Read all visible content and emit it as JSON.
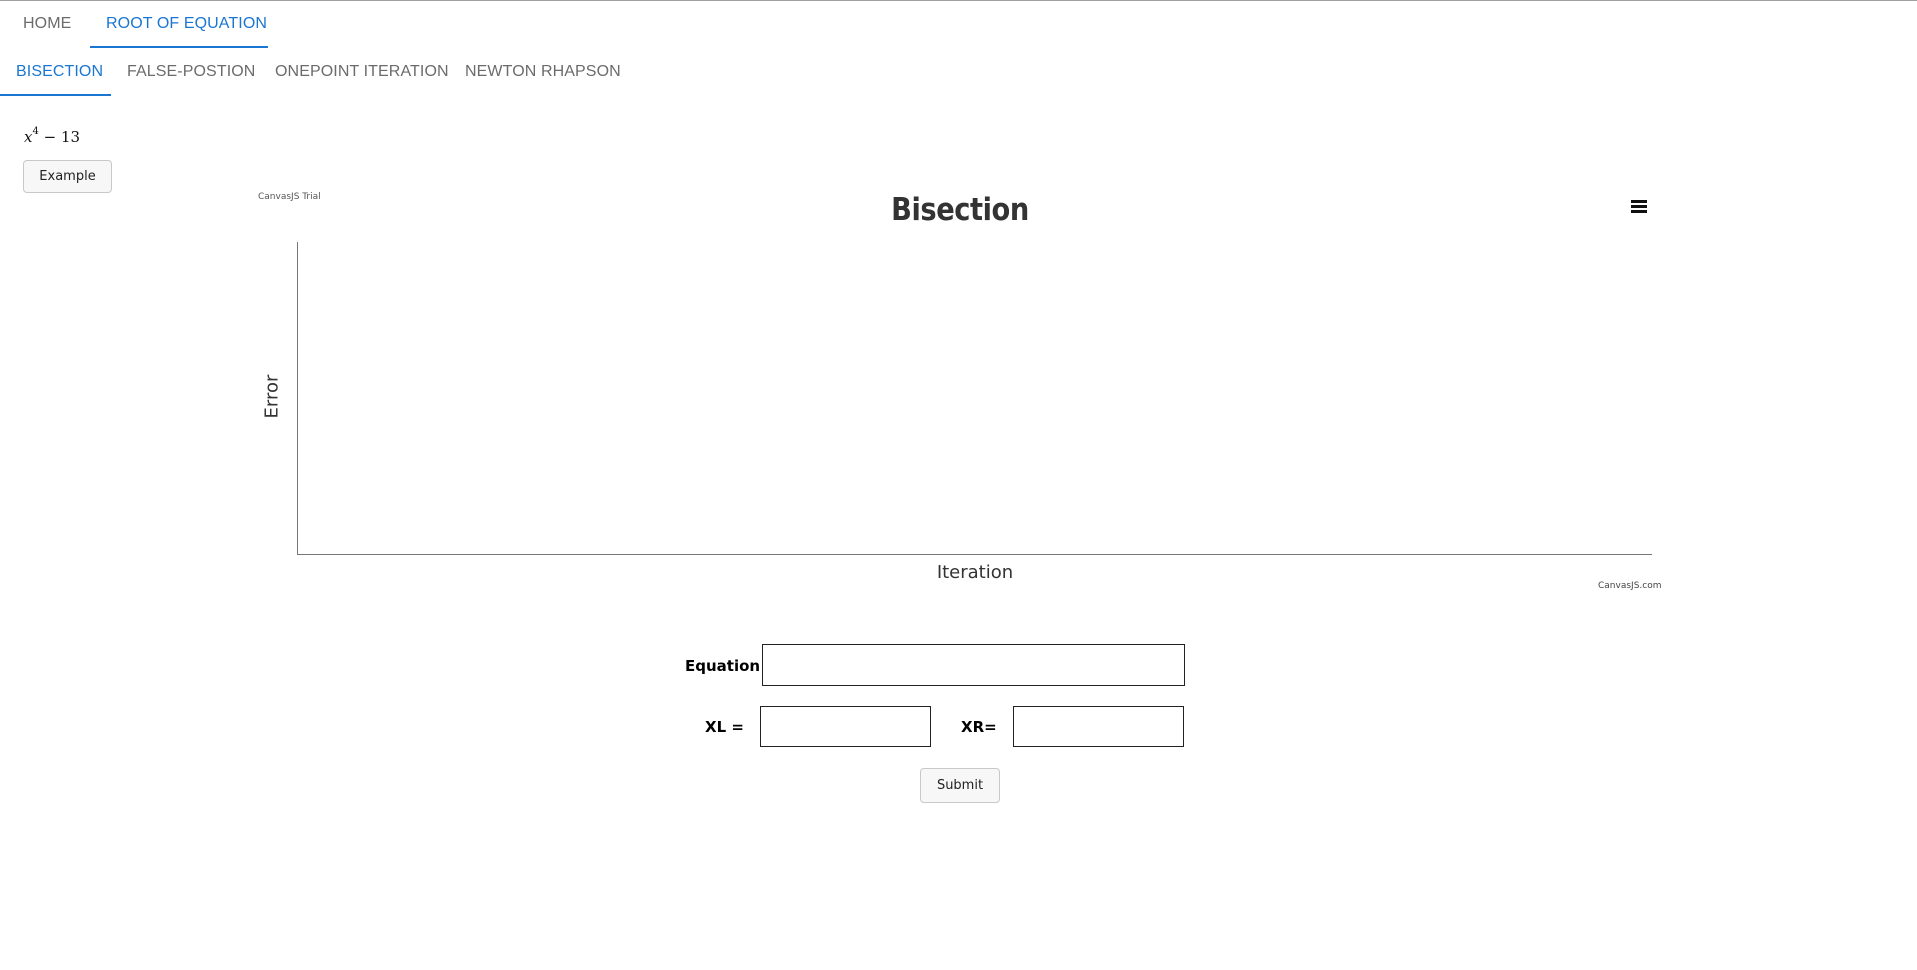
{
  "nav": {
    "tabs": [
      {
        "label": "HOME",
        "active": false
      },
      {
        "label": "ROOT OF EQUATION",
        "active": true
      }
    ],
    "subtabs": [
      {
        "label": "BISECTION",
        "active": true
      },
      {
        "label": "FALSE-POSTION",
        "active": false
      },
      {
        "label": "ONEPOINT ITERATION",
        "active": false
      },
      {
        "label": "NEWTON RHAPSON",
        "active": false
      }
    ]
  },
  "equation": {
    "variable": "x",
    "exponent": "4",
    "rest": "− 13"
  },
  "example_button": "Example",
  "chart_data": {
    "type": "line",
    "title": "Bisection",
    "xlabel": "Iteration",
    "ylabel": "Error",
    "series": [],
    "watermark": "CanvasJS Trial",
    "credit": "CanvasJS.com",
    "menu_icon": "hamburger-menu-icon"
  },
  "form": {
    "equation_label": "Equation",
    "equation_value": "",
    "xl_label": "XL =",
    "xl_value": "",
    "xr_label": "XR=",
    "xr_value": "",
    "submit_label": "Submit"
  },
  "colors": {
    "accent": "#1976d2",
    "tab_inactive": "#6b6b6b"
  }
}
